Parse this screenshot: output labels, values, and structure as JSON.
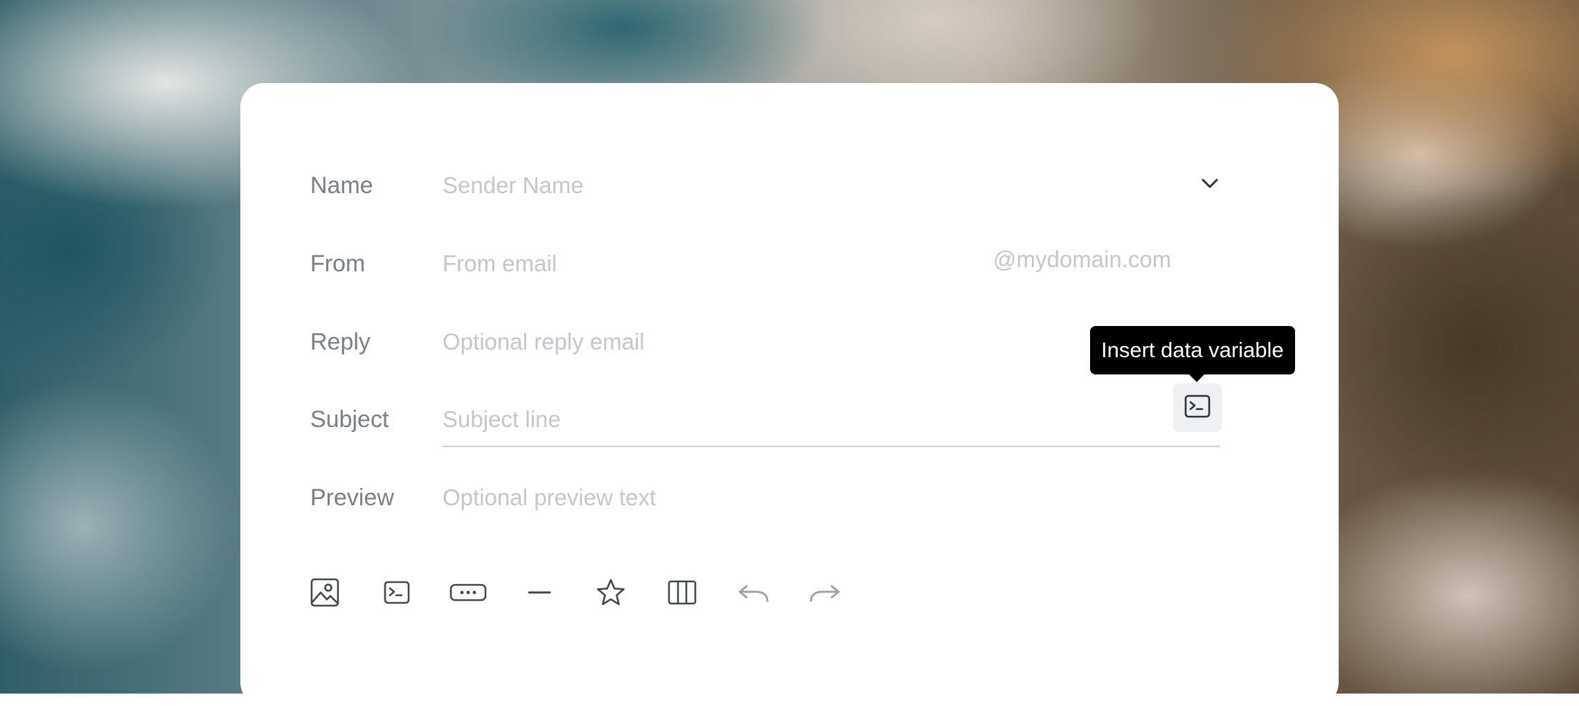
{
  "form": {
    "name": {
      "label": "Name",
      "placeholder": "Sender Name"
    },
    "from": {
      "label": "From",
      "placeholder": "From email",
      "suffix": "@mydomain.com"
    },
    "reply": {
      "label": "Reply",
      "placeholder": "Optional reply email"
    },
    "subject": {
      "label": "Subject",
      "placeholder": "Subject line"
    },
    "preview": {
      "label": "Preview",
      "placeholder": "Optional preview text"
    }
  },
  "tooltip": {
    "text": "Insert data variable"
  },
  "toolbar": {
    "icons": [
      "image-icon",
      "terminal-icon",
      "button-icon",
      "divider-icon",
      "star-icon",
      "columns-icon",
      "undo-icon",
      "redo-icon"
    ]
  },
  "colors": {
    "label": "#7a8088",
    "placeholder": "#c3c7cd",
    "icon": "#3f464e",
    "icon_disabled": "#9ea3a9",
    "tooltip_bg": "#000000"
  }
}
